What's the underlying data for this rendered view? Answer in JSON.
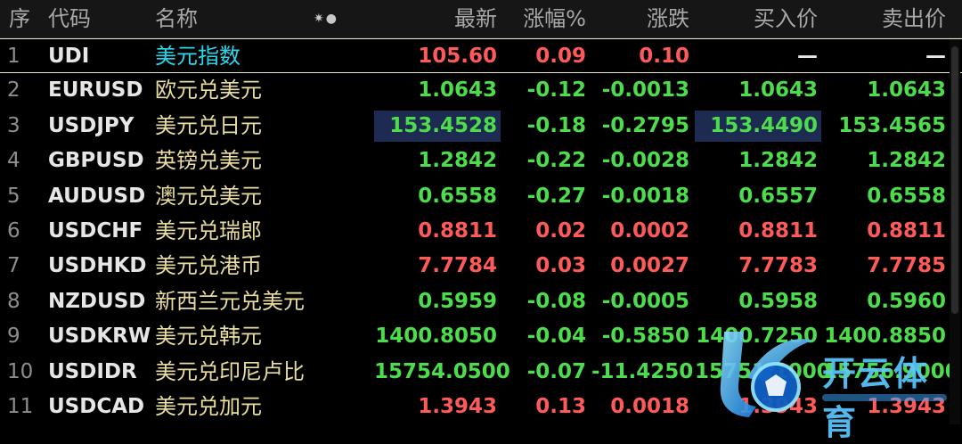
{
  "header": {
    "col_index": "序",
    "col_code": "代码",
    "col_name": "名称",
    "icons": "✷●",
    "col_last": "最新",
    "col_change_pct": "涨幅%",
    "col_change": "涨跌",
    "col_bid": "买入价",
    "col_ask": "卖出价"
  },
  "colors": {
    "up": "#ff5a5a",
    "down": "#4cdc4c",
    "name": "#e9dea0",
    "index_name": "#27d8ec",
    "highlight": "#1d2a52"
  },
  "rows": [
    {
      "index": "1",
      "code": "UDI",
      "name": "美元指数",
      "last": "105.60",
      "change_pct": "0.09",
      "change": "0.10",
      "bid": "—",
      "ask": "—"
    },
    {
      "index": "2",
      "code": "EURUSD",
      "name": "欧元兑美元",
      "last": "1.0643",
      "change_pct": "-0.12",
      "change": "-0.0013",
      "bid": "1.0643",
      "ask": "1.0643"
    },
    {
      "index": "3",
      "code": "USDJPY",
      "name": "美元兑日元",
      "last": "153.4528",
      "change_pct": "-0.18",
      "change": "-0.2795",
      "bid": "153.4490",
      "ask": "153.4565"
    },
    {
      "index": "4",
      "code": "GBPUSD",
      "name": "英镑兑美元",
      "last": "1.2842",
      "change_pct": "-0.22",
      "change": "-0.0028",
      "bid": "1.2842",
      "ask": "1.2842"
    },
    {
      "index": "5",
      "code": "AUDUSD",
      "name": "澳元兑美元",
      "last": "0.6558",
      "change_pct": "-0.27",
      "change": "-0.0018",
      "bid": "0.6557",
      "ask": "0.6558"
    },
    {
      "index": "6",
      "code": "USDCHF",
      "name": "美元兑瑞郎",
      "last": "0.8811",
      "change_pct": "0.02",
      "change": "0.0002",
      "bid": "0.8811",
      "ask": "0.8811"
    },
    {
      "index": "7",
      "code": "USDHKD",
      "name": "美元兑港币",
      "last": "7.7784",
      "change_pct": "0.03",
      "change": "0.0027",
      "bid": "7.7783",
      "ask": "7.7785"
    },
    {
      "index": "8",
      "code": "NZDUSD",
      "name": "新西兰元兑美元",
      "last": "0.5959",
      "change_pct": "-0.08",
      "change": "-0.0005",
      "bid": "0.5958",
      "ask": "0.5960"
    },
    {
      "index": "9",
      "code": "USDKRW",
      "name": "美元兑韩元",
      "last": "1400.8050",
      "change_pct": "-0.04",
      "change": "-0.5850",
      "bid": "1400.7250",
      "ask": "1400.8850"
    },
    {
      "index": "10",
      "code": "USDIDR",
      "name": "美元兑印尼卢比",
      "last": "15754.0500",
      "change_pct": "-0.07",
      "change": "-11.4250",
      "bid": "15751.1000",
      "ask": "15756.9000"
    },
    {
      "index": "11",
      "code": "USDCAD",
      "name": "美元兑加元",
      "last": "1.3943",
      "change_pct": "0.13",
      "change": "0.0018",
      "bid": "1.3943",
      "ask": "1.3943"
    }
  ],
  "watermark": {
    "text": "开云体育"
  }
}
